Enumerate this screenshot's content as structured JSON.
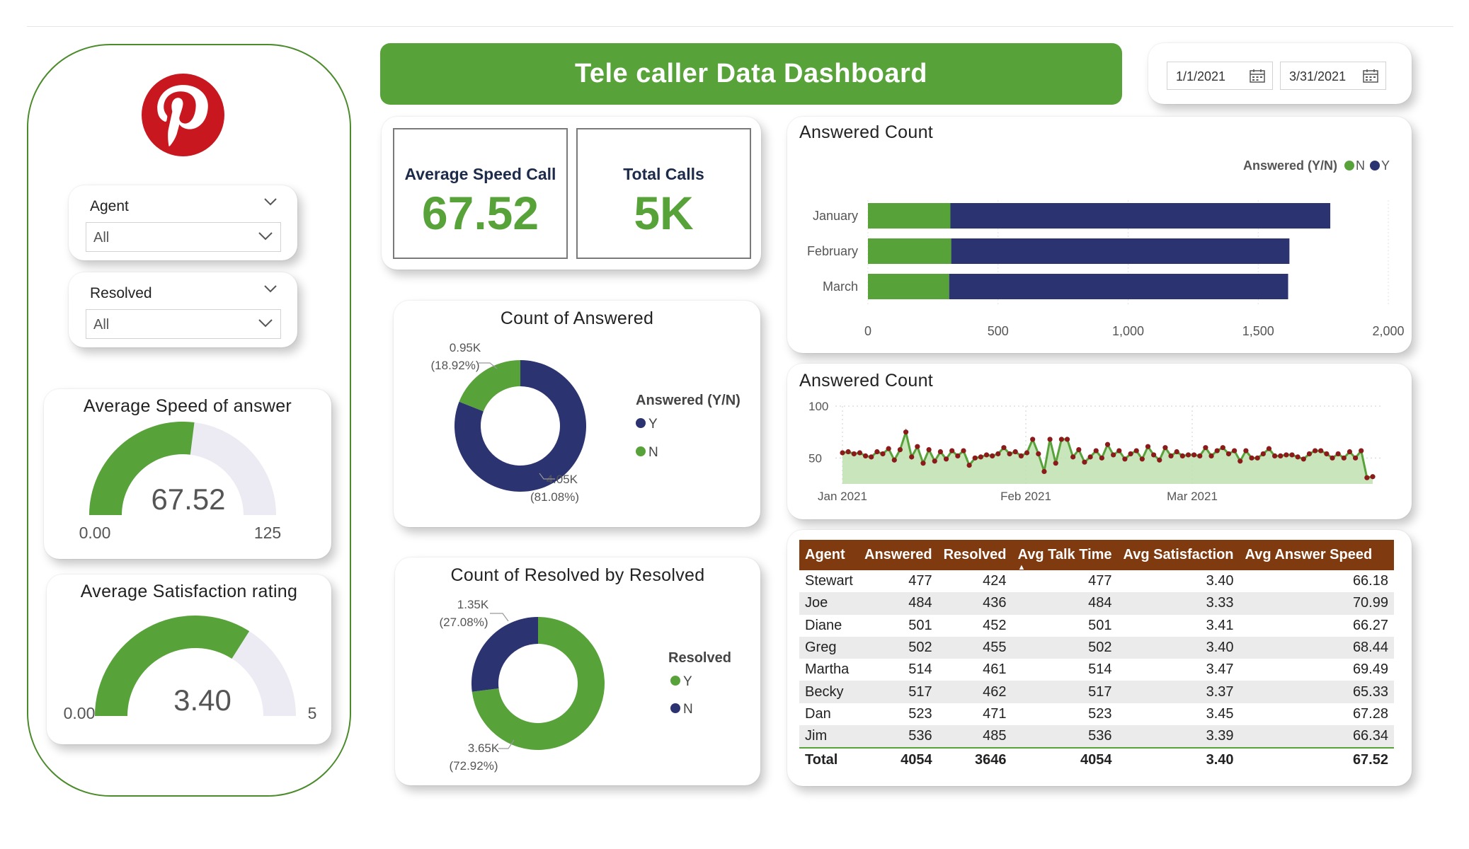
{
  "header": {
    "title": "Tele caller Data Dashboard"
  },
  "dates": {
    "start": "1/1/2021",
    "end": "3/31/2021"
  },
  "filters": [
    {
      "title": "Agent",
      "value": "All"
    },
    {
      "title": "Resolved",
      "value": "All"
    }
  ],
  "gauges": [
    {
      "title": "Average Speed of answer",
      "value": "67.52",
      "min": "0.00",
      "max": "125",
      "fraction": 0.54
    },
    {
      "title": "Average Satisfaction rating",
      "value": "3.40",
      "min": "0.00",
      "max": "5",
      "fraction": 0.68
    }
  ],
  "kpis": [
    {
      "label": "Average Speed Call",
      "value": "67.52"
    },
    {
      "label": "Total Calls",
      "value": "5K"
    }
  ],
  "colors": {
    "green": "#58a23a",
    "navy": "#2b3370",
    "brown": "#7f3a0f",
    "area": "#bfe0b0",
    "marker": "#8b1a1a"
  },
  "charts": [
    {
      "type": "bar",
      "title": "Answered Count",
      "legend_title": "Answered (Y/N)",
      "legend": [
        "N",
        "Y"
      ],
      "categories": [
        "January",
        "February",
        "March"
      ],
      "series": [
        {
          "name": "N",
          "values": [
            317,
            320,
            312
          ]
        },
        {
          "name": "Y",
          "values": [
            1460,
            1300,
            1303
          ]
        }
      ],
      "xticks": [
        "0",
        "500",
        "1,000",
        "1,500",
        "2,000"
      ],
      "xlim": [
        0,
        2000
      ]
    },
    {
      "type": "area",
      "title": "Answered Count",
      "yticks": [
        "100",
        "50"
      ],
      "ylim": [
        25,
        100
      ],
      "xticks": [
        "Jan 2021",
        "Feb 2021",
        "Mar 2021"
      ],
      "values": [
        55,
        56,
        54,
        55,
        52,
        51,
        56,
        54,
        59,
        48,
        58,
        75,
        51,
        61,
        45,
        58,
        47,
        56,
        49,
        57,
        52,
        57,
        43,
        50,
        51,
        53,
        52,
        54,
        60,
        54,
        56,
        52,
        55,
        68,
        54,
        37,
        68,
        45,
        68,
        68,
        51,
        58,
        46,
        51,
        57,
        50,
        63,
        53,
        57,
        49,
        54,
        57,
        49,
        61,
        53,
        48,
        60,
        52,
        56,
        52,
        53,
        53,
        52,
        60,
        52,
        57,
        60,
        54,
        57,
        47,
        57,
        50,
        50,
        54,
        59,
        52,
        52,
        53,
        53,
        51,
        49,
        54,
        57,
        57,
        54,
        50,
        54,
        50,
        56,
        50,
        57,
        31,
        32
      ]
    },
    {
      "type": "pie",
      "title": "Count of Answered",
      "legend_title": "Answered (Y/N)",
      "legend": [
        "Y",
        "N"
      ],
      "slices": [
        {
          "name": "Y",
          "value": 4.05,
          "label": "4.05K",
          "pct": "(81.08%)"
        },
        {
          "name": "N",
          "value": 0.95,
          "label": "0.95K",
          "pct": "(18.92%)"
        }
      ]
    },
    {
      "type": "pie",
      "title": "Count of Resolved by Resolved",
      "legend_title": "Resolved",
      "legend": [
        "Y",
        "N"
      ],
      "slices": [
        {
          "name": "Y",
          "value": 3.65,
          "label": "3.65K",
          "pct": "(72.92%)"
        },
        {
          "name": "N",
          "value": 1.35,
          "label": "1.35K",
          "pct": "(27.08%)"
        }
      ]
    }
  ],
  "table": {
    "columns": [
      "Agent",
      "Answered",
      "Resolved",
      "Avg Talk Time",
      "Avg Satisfaction",
      "Avg Answer Speed"
    ],
    "rows": [
      [
        "Stewart",
        "477",
        "424",
        "477",
        "3.40",
        "66.18"
      ],
      [
        "Joe",
        "484",
        "436",
        "484",
        "3.33",
        "70.99"
      ],
      [
        "Diane",
        "501",
        "452",
        "501",
        "3.41",
        "66.27"
      ],
      [
        "Greg",
        "502",
        "455",
        "502",
        "3.40",
        "68.44"
      ],
      [
        "Martha",
        "514",
        "461",
        "514",
        "3.47",
        "69.49"
      ],
      [
        "Becky",
        "517",
        "462",
        "517",
        "3.37",
        "65.33"
      ],
      [
        "Dan",
        "523",
        "471",
        "523",
        "3.45",
        "67.28"
      ],
      [
        "Jim",
        "536",
        "485",
        "536",
        "3.39",
        "66.34"
      ]
    ],
    "total": [
      "Total",
      "4054",
      "3646",
      "4054",
      "3.40",
      "67.52"
    ]
  }
}
